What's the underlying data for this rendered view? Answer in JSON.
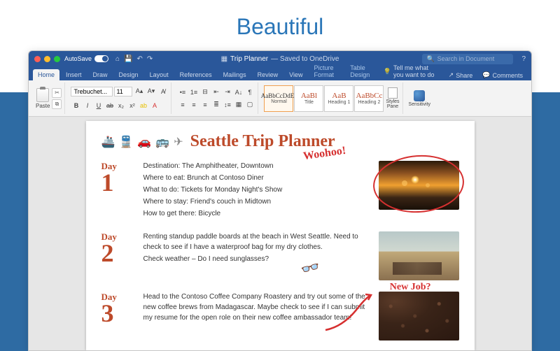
{
  "hero": {
    "title": "Beautiful"
  },
  "titlebar": {
    "autosave_label": "AutoSave",
    "doc_name": "Trip Planner",
    "doc_status": "— Saved to OneDrive",
    "search_placeholder": "Search in Document"
  },
  "tabs": {
    "home": "Home",
    "insert": "Insert",
    "draw": "Draw",
    "design": "Design",
    "layout": "Layout",
    "references": "References",
    "mailings": "Mailings",
    "review": "Review",
    "view": "View",
    "picture_format": "Picture Format",
    "table_design": "Table Design",
    "tell_me": "Tell me what you want to do",
    "share": "Share",
    "comments": "Comments"
  },
  "ribbon": {
    "paste": "Paste",
    "font_name": "Trebuchet...",
    "font_size": "11",
    "styles": {
      "normal": {
        "preview": "AaBbCcDdEe",
        "label": "Normal"
      },
      "title": {
        "preview": "AaBl",
        "label": "Title"
      },
      "h1": {
        "preview": "AaB",
        "label": "Heading 1"
      },
      "h2": {
        "preview": "AaBbCc",
        "label": "Heading 2"
      }
    },
    "styles_pane": "Styles\nPane",
    "sensitivity": "Sensitivity"
  },
  "document": {
    "title": "Seattle Trip Planner",
    "annotations": {
      "woohoo": "Woohoo!",
      "newjob": "New Job?"
    },
    "days": [
      {
        "label": "Day",
        "num": "1",
        "lines": [
          "Destination: The Amphitheater, Downtown",
          "Where to eat: Brunch at Contoso Diner",
          "What to do: Tickets for Monday Night's Show",
          "Where to stay: Friend's couch in Midtown",
          "How to get there: Bicycle"
        ]
      },
      {
        "label": "Day",
        "num": "2",
        "lines": [
          "Renting standup paddle boards at the beach in West Seattle. Need to check to see if I have a waterproof bag for my dry clothes.",
          "",
          "Check weather – Do I need sunglasses?"
        ]
      },
      {
        "label": "Day",
        "num": "3",
        "lines": [
          "Head to the Contoso Coffee Company Roastery and try out some of the new coffee brews from Madagascar. Maybe check to see if I can submit my resume for the open role on their new coffee ambassador team!"
        ]
      }
    ]
  }
}
